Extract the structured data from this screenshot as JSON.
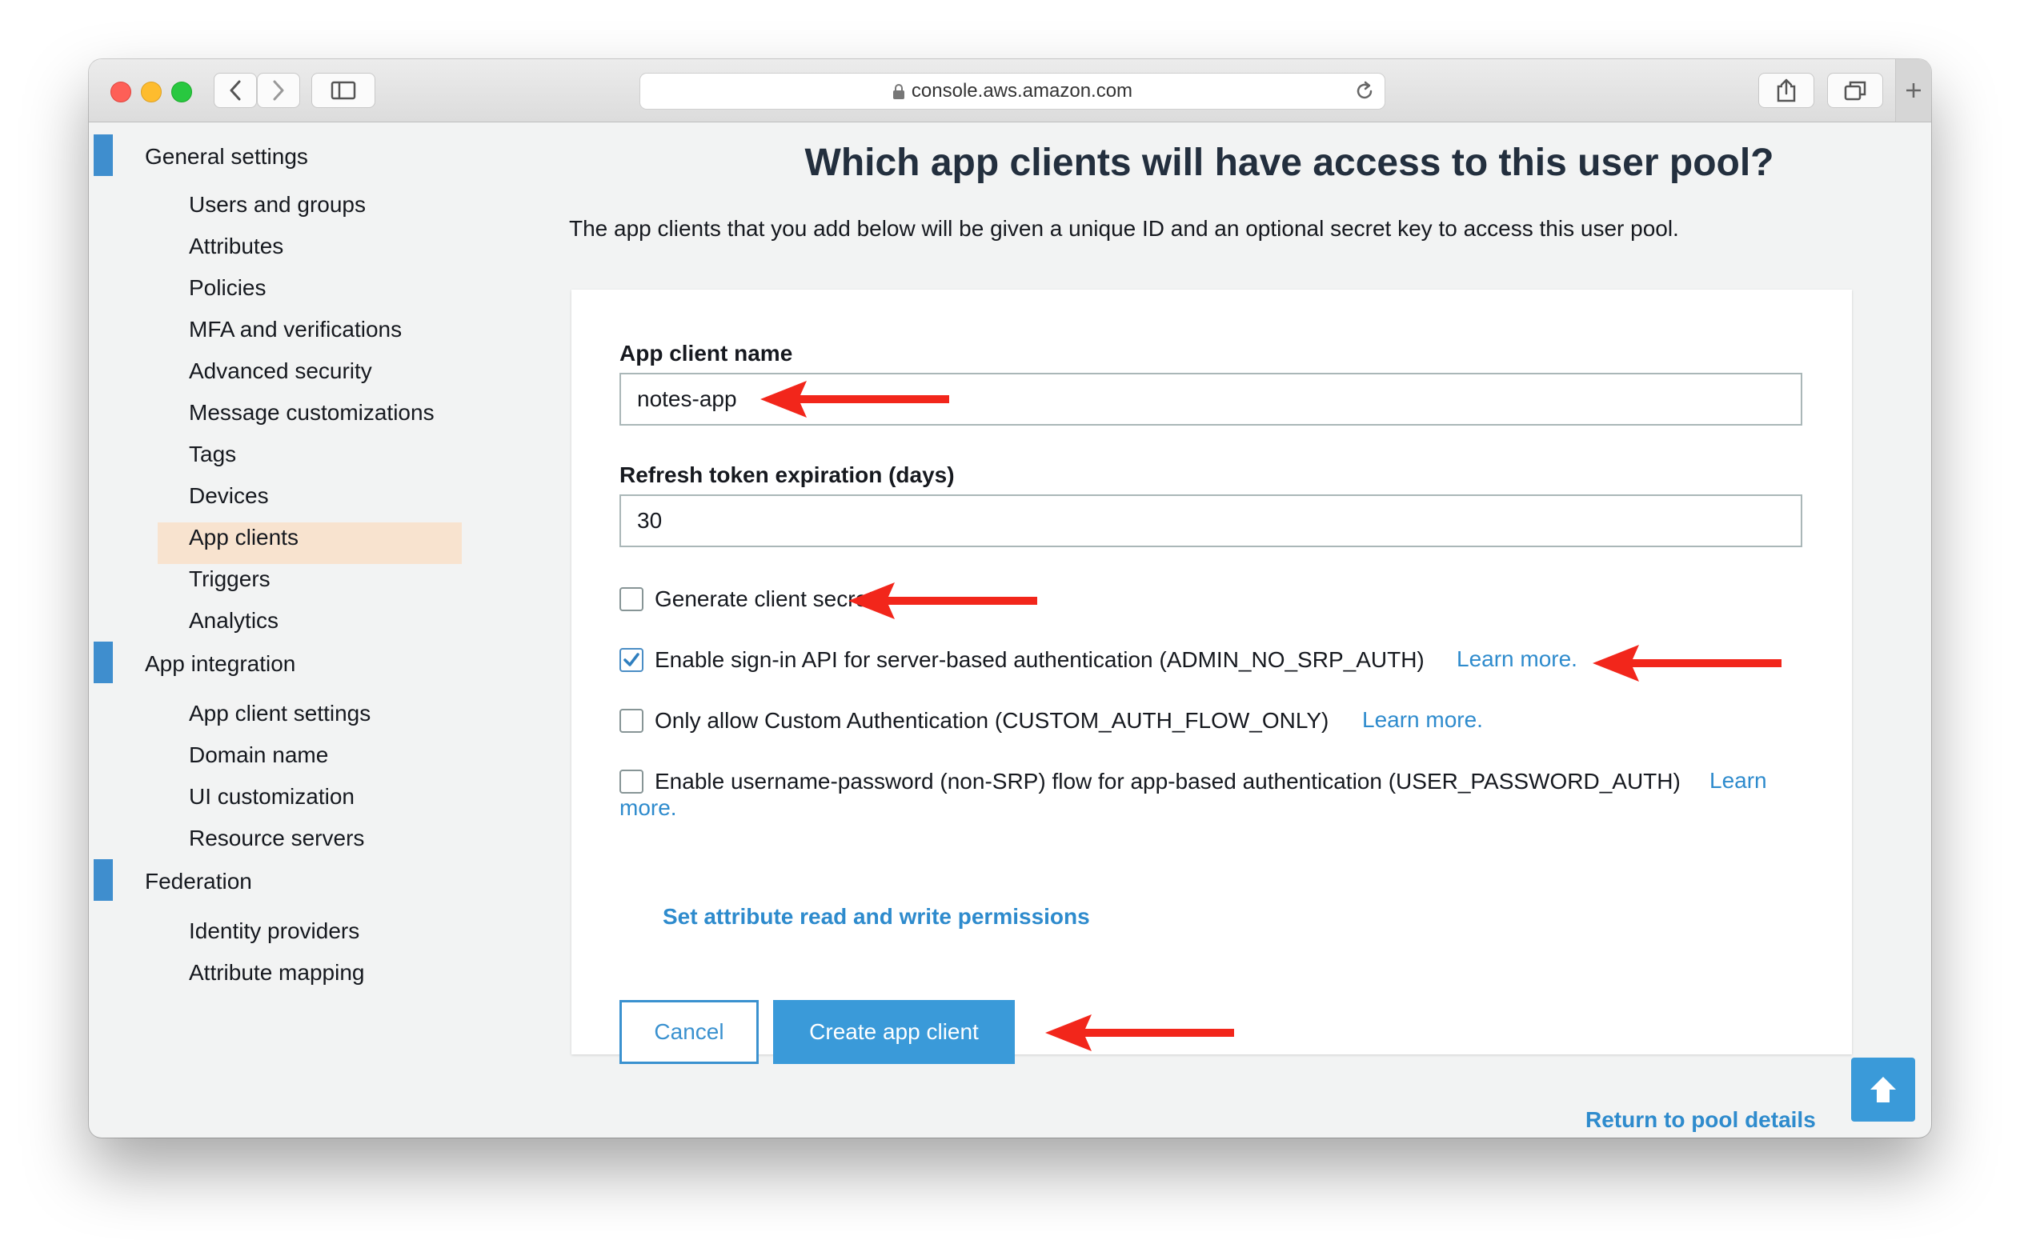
{
  "browser": {
    "url": "console.aws.amazon.com"
  },
  "sidebar": {
    "sections": [
      {
        "title": "General settings",
        "items": [
          "Users and groups",
          "Attributes",
          "Policies",
          "MFA and verifications",
          "Advanced security",
          "Message customizations",
          "Tags",
          "Devices",
          "App clients",
          "Triggers",
          "Analytics"
        ]
      },
      {
        "title": "App integration",
        "items": [
          "App client settings",
          "Domain name",
          "UI customization",
          "Resource servers"
        ]
      },
      {
        "title": "Federation",
        "items": [
          "Identity providers",
          "Attribute mapping"
        ]
      }
    ],
    "selected": "App clients"
  },
  "main": {
    "title": "Which app clients will have access to this user pool?",
    "description": "The app clients that you add below will be given a unique ID and an optional secret key to access this user pool.",
    "form": {
      "app_client_name_label": "App client name",
      "app_client_name_value": "notes-app",
      "refresh_label": "Refresh token expiration (days)",
      "refresh_value": "30",
      "options": [
        {
          "label": "Generate client secret",
          "checked": false
        },
        {
          "label": "Enable sign-in API for server-based authentication (ADMIN_NO_SRP_AUTH)",
          "checked": true,
          "link": "Learn more."
        },
        {
          "label": "Only allow Custom Authentication (CUSTOM_AUTH_FLOW_ONLY)",
          "checked": false,
          "link": "Learn more."
        },
        {
          "label": "Enable username-password (non-SRP) flow for app-based authentication (USER_PASSWORD_AUTH)",
          "checked": false,
          "link_part1": "Learn",
          "link_part2": "more."
        }
      ],
      "permissions_link": "Set attribute read and write permissions",
      "cancel_label": "Cancel",
      "create_label": "Create app client"
    },
    "return_link": "Return to pool details"
  },
  "colors": {
    "accent": "#3a9ad9",
    "link": "#2e8bcd",
    "annotation_arrow": "#f2261b",
    "selected_nav": "#f8e3cf",
    "section_bar": "#3f8ece"
  },
  "icons": [
    "back-icon",
    "forward-icon",
    "sidebar-icon",
    "lock-icon",
    "reload-icon",
    "share-icon",
    "tabs-icon",
    "plus-icon",
    "checkmark-icon",
    "arrow-up-icon",
    "annotation-arrow"
  ]
}
